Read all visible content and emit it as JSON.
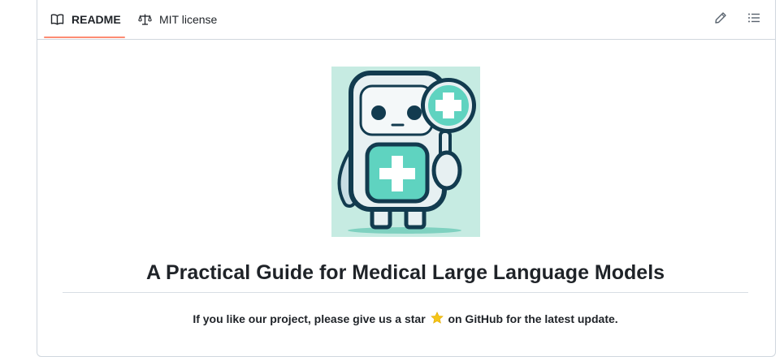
{
  "tabs": {
    "readme_label": "README",
    "license_label": "MIT license"
  },
  "icons": {
    "readme": "book-icon",
    "license": "scale-icon",
    "edit": "pencil-icon",
    "outline": "list-icon",
    "star": "star-icon"
  },
  "colors": {
    "tab_underline": "#fd8c73",
    "logo_background": "#c6ebe2",
    "star": "#f5c518"
  },
  "readme": {
    "title": "A Practical Guide for Medical Large Language Models",
    "star_prefix": "If you like our project, please give us a star",
    "star_suffix": "on GitHub for the latest update."
  }
}
